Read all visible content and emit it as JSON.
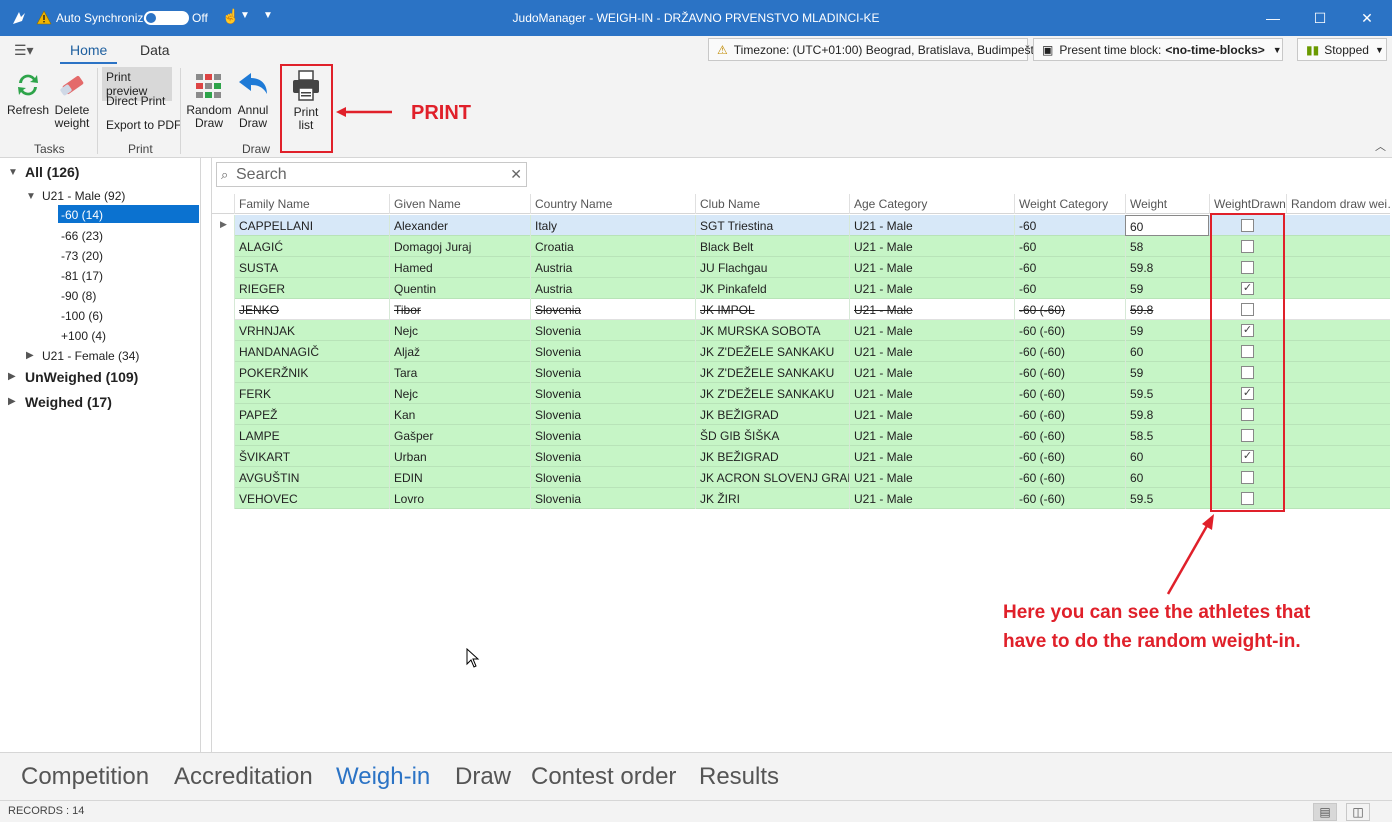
{
  "titlebar": {
    "auto_sync_label": "Auto Synchronize",
    "toggle_state": "Off",
    "title": "JudoManager - WEIGH-IN - DRŽAVNO PRVENSTVO MLADINCI-KE"
  },
  "ribbon": {
    "tabs": [
      {
        "label": "Home"
      },
      {
        "label": "Data"
      }
    ],
    "timezone": "Timezone: (UTC+01:00) Beograd, Bratislava, Budimpešt…",
    "time_block_label": "Present time block:",
    "time_block_value": "<no-time-blocks>",
    "status": "Stopped",
    "buttons": {
      "refresh": "Refresh",
      "delete_weight_1": "Delete",
      "delete_weight_2": "weight",
      "print_preview": "Print preview",
      "direct_print": "Direct Print",
      "export_pdf": "Export to PDF",
      "random_draw_1": "Random",
      "random_draw_2": "Draw",
      "annul_draw_1": "Annul",
      "annul_draw_2": "Draw",
      "print_list_1": "Print",
      "print_list_2": "list"
    },
    "groups": {
      "tasks": "Tasks",
      "print": "Print",
      "draw": "Draw"
    },
    "callout": "PRINT"
  },
  "tree": {
    "all": "All (126)",
    "male": "U21 - Male (92)",
    "categories": [
      "-60 (14)",
      "-66 (23)",
      "-73 (20)",
      "-81 (17)",
      "-90 (8)",
      "-100 (6)",
      "+100 (4)"
    ],
    "female": "U21 - Female (34)",
    "unweighed": "UnWeighed (109)",
    "weighed": "Weighed (17)"
  },
  "search": {
    "placeholder": "Search"
  },
  "grid": {
    "columns": [
      "Family Name",
      "Given Name",
      "Country Name",
      "Club Name",
      "Age Category",
      "Weight Category",
      "Weight",
      "WeightDrawn",
      "Random draw wei…"
    ],
    "rows": [
      {
        "family": "CAPPELLANI",
        "given": "Alexander",
        "country": "Italy",
        "club": "SGT Triestina",
        "age": "U21 - Male",
        "wcat": "-60",
        "weight": "60",
        "drawn": false
      },
      {
        "family": "ALAGIĆ",
        "given": "Domagoj Juraj",
        "country": "Croatia",
        "club": "Black Belt",
        "age": "U21 - Male",
        "wcat": "-60",
        "weight": "58",
        "drawn": false
      },
      {
        "family": "SUSTA",
        "given": "Hamed",
        "country": "Austria",
        "club": "JU Flachgau",
        "age": "U21 - Male",
        "wcat": "-60",
        "weight": "59.8",
        "drawn": false
      },
      {
        "family": "RIEGER",
        "given": "Quentin",
        "country": "Austria",
        "club": "JK Pinkafeld",
        "age": "U21 - Male",
        "wcat": "-60",
        "weight": "59",
        "drawn": true
      },
      {
        "family": "JENKO",
        "given": "Tibor",
        "country": "Slovenia",
        "club": "JK IMPOL",
        "age": "U21 - Male",
        "wcat": "-60 (-60)",
        "weight": "59.8",
        "drawn": false
      },
      {
        "family": "VRHNJAK",
        "given": "Nejc",
        "country": "Slovenia",
        "club": "JK MURSKA SOBOTA",
        "age": "U21 - Male",
        "wcat": "-60 (-60)",
        "weight": "59",
        "drawn": true
      },
      {
        "family": "HANDANAGIČ",
        "given": "Aljaž",
        "country": "Slovenia",
        "club": "JK Z'DEŽELE SANKAKU",
        "age": "U21 - Male",
        "wcat": "-60 (-60)",
        "weight": "60",
        "drawn": false
      },
      {
        "family": "POKERŽNIK",
        "given": "Tara",
        "country": "Slovenia",
        "club": "JK Z'DEŽELE SANKAKU",
        "age": "U21 - Male",
        "wcat": "-60 (-60)",
        "weight": "59",
        "drawn": false
      },
      {
        "family": "FERK",
        "given": "Nejc",
        "country": "Slovenia",
        "club": "JK Z'DEŽELE SANKAKU",
        "age": "U21 - Male",
        "wcat": "-60 (-60)",
        "weight": "59.5",
        "drawn": true
      },
      {
        "family": "PAPEŽ",
        "given": "Kan",
        "country": "Slovenia",
        "club": "JK BEŽIGRAD",
        "age": "U21 - Male",
        "wcat": "-60 (-60)",
        "weight": "59.8",
        "drawn": false
      },
      {
        "family": "LAMPE",
        "given": "Gašper",
        "country": "Slovenia",
        "club": "ŠD GIB ŠIŠKA",
        "age": "U21 - Male",
        "wcat": "-60 (-60)",
        "weight": "58.5",
        "drawn": false
      },
      {
        "family": "ŠVIKART",
        "given": "Urban",
        "country": "Slovenia",
        "club": "JK BEŽIGRAD",
        "age": "U21 - Male",
        "wcat": "-60 (-60)",
        "weight": "60",
        "drawn": true
      },
      {
        "family": "AVGUŠTIN",
        "given": "EDIN",
        "country": "Slovenia",
        "club": "JK ACRON SLOVENJ GRADEC",
        "age": "U21 - Male",
        "wcat": "-60 (-60)",
        "weight": "60",
        "drawn": false
      },
      {
        "family": "VEHOVEC",
        "given": "Lovro",
        "country": "Slovenia",
        "club": "JK ŽIRI",
        "age": "U21 - Male",
        "wcat": "-60 (-60)",
        "weight": "59.5",
        "drawn": false
      }
    ]
  },
  "annotation": {
    "line1": "Here you can see the athletes that",
    "line2": "have to do the random weight-in."
  },
  "bottom_nav": [
    "Competition",
    "Accreditation",
    "Weigh-in",
    "Draw",
    "Contest order",
    "Results"
  ],
  "status": {
    "records": "RECORDS : 14"
  },
  "colors": {
    "accent": "#2b73c5",
    "row_green": "#c6f5c6",
    "highlight_red": "#e0202a"
  }
}
